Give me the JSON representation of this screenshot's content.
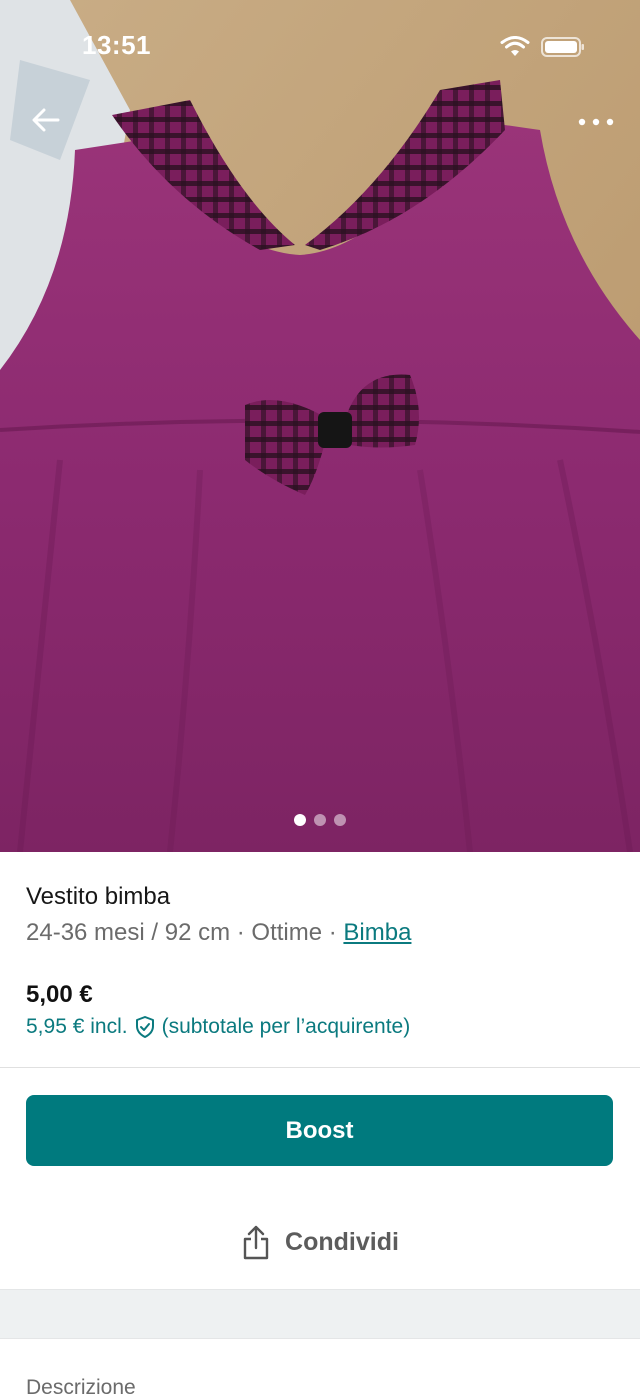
{
  "status_bar": {
    "time": "13:51",
    "icons": [
      "wifi-icon",
      "battery-icon"
    ]
  },
  "hero": {
    "back_icon": "arrow-left-icon",
    "more_icon": "more-horizontal-icon",
    "photo_count": 3,
    "active_photo_index": 0
  },
  "item": {
    "title": "Vestito bimba",
    "subtitle_text": "24-36 mesi / 92 cm · Ottime · ",
    "category_link": "Bimba",
    "price": "5,00 €",
    "price_incl": "5,95 € incl.",
    "buyer_note": "(subtotale per l’acquirente)"
  },
  "actions": {
    "boost_label": "Boost",
    "share_label": "Condividi",
    "share_icon": "share-icon"
  },
  "description": {
    "heading": "Descrizione"
  },
  "colors": {
    "accent": "#007a7e",
    "link": "#0b7a7f",
    "dress": "#8f2b73"
  }
}
